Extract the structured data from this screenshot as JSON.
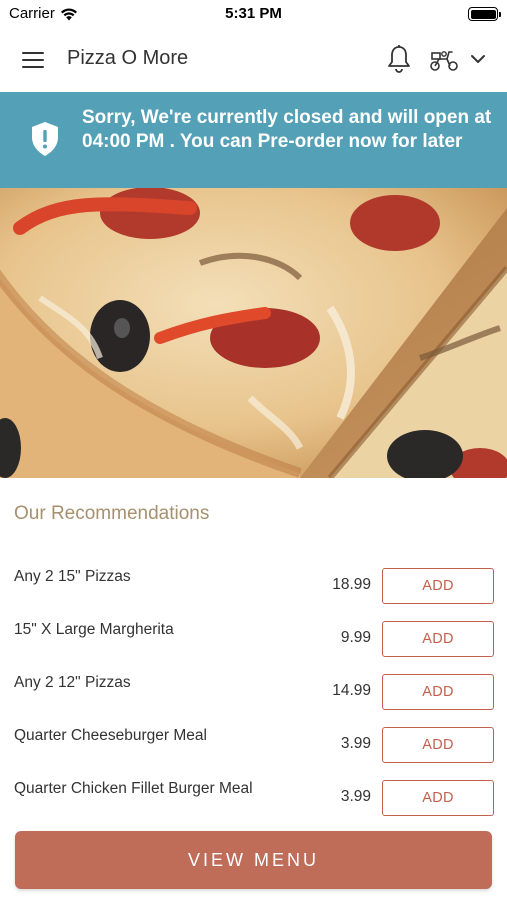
{
  "status_bar": {
    "carrier": "Carrier",
    "time": "5:31 PM"
  },
  "header": {
    "title": "Pizza O More",
    "icons": [
      "menu-icon",
      "bell-icon",
      "delivery-scooter-icon",
      "chevron-down-icon"
    ]
  },
  "banner": {
    "message": "Sorry, We're currently closed and will open at 04:00 PM . You can Pre-order now for later",
    "icon": "shield-exclamation-icon",
    "color": "#54a0b7"
  },
  "recommendations": {
    "title": "Our Recommendations",
    "items": [
      {
        "name": "Any 2 15\" Pizzas",
        "price": "18.99",
        "action": "ADD"
      },
      {
        "name": "15\" X Large Margherita",
        "price": "9.99",
        "action": "ADD"
      },
      {
        "name": "Any 2 12\" Pizzas",
        "price": "14.99",
        "action": "ADD"
      },
      {
        "name": "Quarter Cheeseburger Meal",
        "price": "3.99",
        "action": "ADD"
      },
      {
        "name": "Quarter Chicken Fillet Burger Meal",
        "price": "3.99",
        "action": "ADD"
      }
    ]
  },
  "footer": {
    "view_menu_label": "VIEW MENU"
  },
  "colors": {
    "accent": "#bf6c58",
    "add_button_border": "#c2604d",
    "section_title": "#a6916f"
  }
}
